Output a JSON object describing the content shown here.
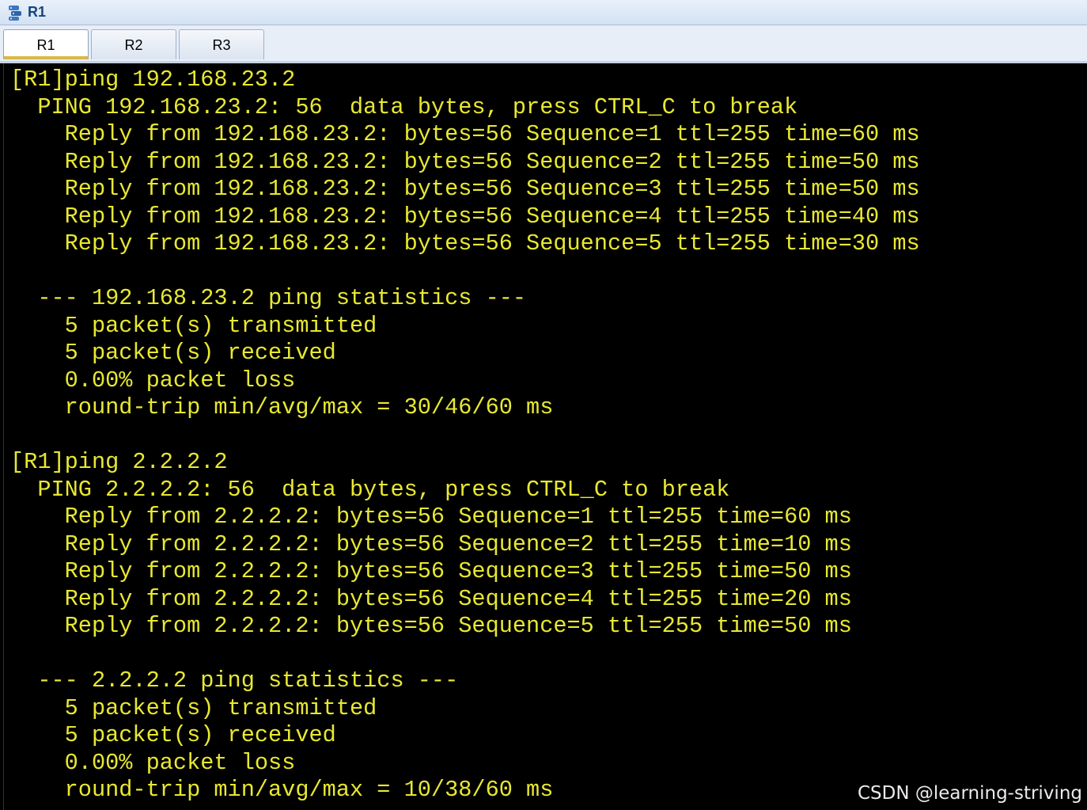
{
  "window": {
    "title": "R1",
    "icon": "router-app-icon",
    "accent_color": "#e8e832",
    "background_color": "#000000"
  },
  "tabs": [
    {
      "label": "R1",
      "active": true
    },
    {
      "label": "R2",
      "active": false
    },
    {
      "label": "R3",
      "active": false
    }
  ],
  "terminal": {
    "lines": [
      "[R1]ping 192.168.23.2",
      "  PING 192.168.23.2: 56  data bytes, press CTRL_C to break",
      "    Reply from 192.168.23.2: bytes=56 Sequence=1 ttl=255 time=60 ms",
      "    Reply from 192.168.23.2: bytes=56 Sequence=2 ttl=255 time=50 ms",
      "    Reply from 192.168.23.2: bytes=56 Sequence=3 ttl=255 time=50 ms",
      "    Reply from 192.168.23.2: bytes=56 Sequence=4 ttl=255 time=40 ms",
      "    Reply from 192.168.23.2: bytes=56 Sequence=5 ttl=255 time=30 ms",
      "",
      "  --- 192.168.23.2 ping statistics ---",
      "    5 packet(s) transmitted",
      "    5 packet(s) received",
      "    0.00% packet loss",
      "    round-trip min/avg/max = 30/46/60 ms",
      "",
      "[R1]ping 2.2.2.2",
      "  PING 2.2.2.2: 56  data bytes, press CTRL_C to break",
      "    Reply from 2.2.2.2: bytes=56 Sequence=1 ttl=255 time=60 ms",
      "    Reply from 2.2.2.2: bytes=56 Sequence=2 ttl=255 time=10 ms",
      "    Reply from 2.2.2.2: bytes=56 Sequence=3 ttl=255 time=50 ms",
      "    Reply from 2.2.2.2: bytes=56 Sequence=4 ttl=255 time=20 ms",
      "    Reply from 2.2.2.2: bytes=56 Sequence=5 ttl=255 time=50 ms",
      "",
      "  --- 2.2.2.2 ping statistics ---",
      "    5 packet(s) transmitted",
      "    5 packet(s) received",
      "    0.00% packet loss",
      "    round-trip min/avg/max = 10/38/60 ms"
    ]
  },
  "watermark": "CSDN @learning-striving"
}
